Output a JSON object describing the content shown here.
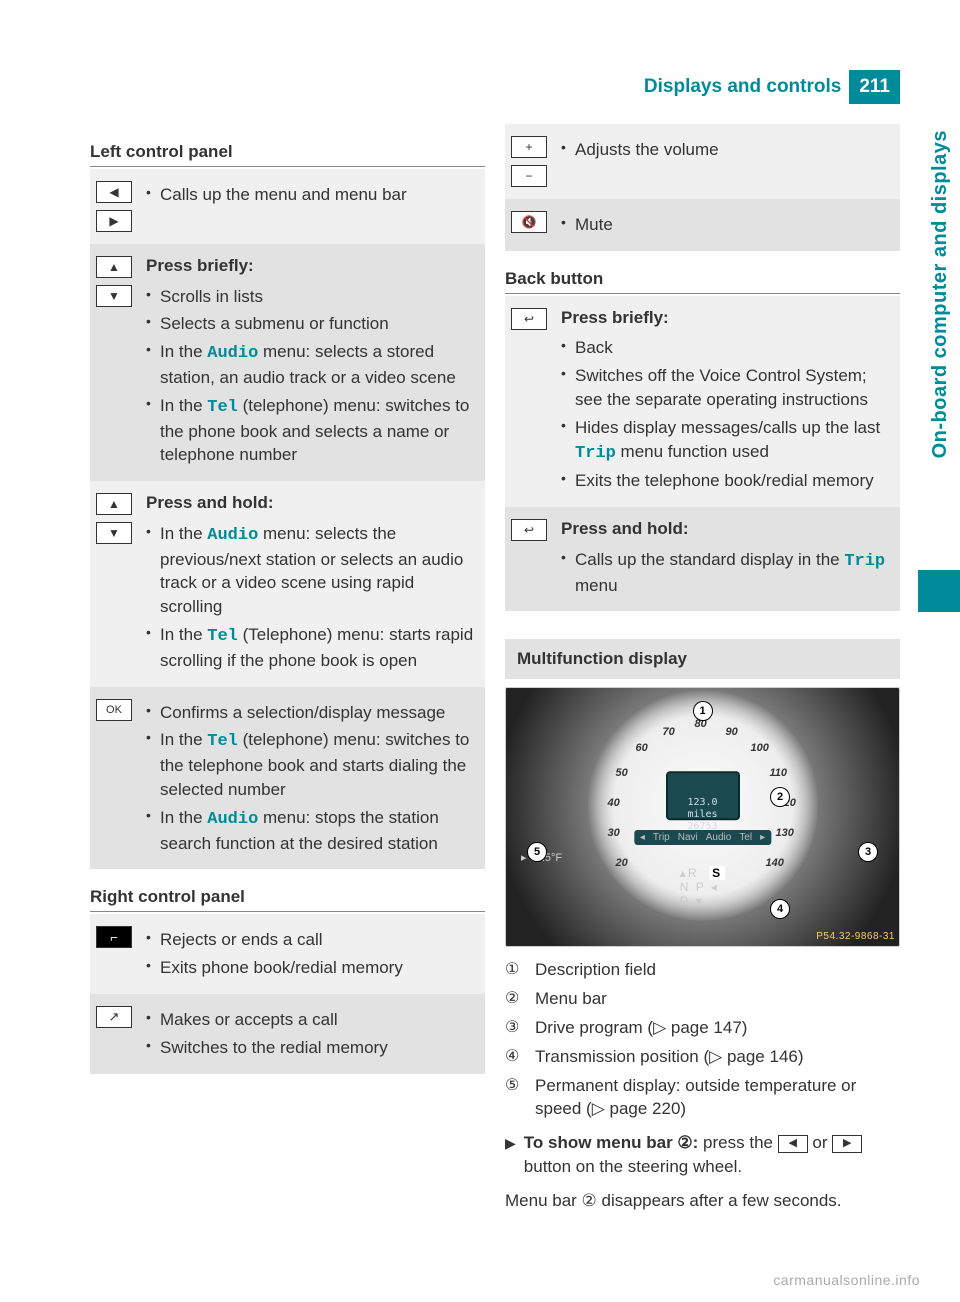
{
  "header": {
    "section": "Displays and controls",
    "page": "211"
  },
  "side_tab": "On-board computer and displays",
  "left_panel": {
    "title": "Left control panel",
    "rows": [
      {
        "items": [
          "Calls up the menu and menu bar"
        ]
      },
      {
        "heading": "Press briefly:",
        "items": [
          "Scrolls in lists",
          "Selects a submenu or function",
          {
            "pre": "In the ",
            "mono": "Audio",
            "post": " menu: selects a stored station, an audio track or a video scene"
          },
          {
            "pre": "In the ",
            "mono": "Tel",
            "post": " (telephone) menu: switches to the phone book and selects a name or telephone number"
          }
        ]
      },
      {
        "heading": "Press and hold:",
        "items": [
          {
            "pre": "In the ",
            "mono": "Audio",
            "post": " menu: selects the previous/next station or selects an audio track or a video scene using rapid scrolling"
          },
          {
            "pre": "In the ",
            "mono": "Tel",
            "post": " (Telephone) menu: starts rapid scrolling if the phone book is open"
          }
        ]
      },
      {
        "items": [
          "Confirms a selection/display message",
          {
            "pre": "In the ",
            "mono": "Tel",
            "post": " (telephone) menu: switches to the telephone book and starts dialing the selected number"
          },
          {
            "pre": "In the ",
            "mono": "Audio",
            "post": " menu: stops the station search function at the desired station"
          }
        ]
      }
    ]
  },
  "right_panel": {
    "title": "Right control panel",
    "rows": [
      {
        "items": [
          "Rejects or ends a call",
          "Exits phone book/redial memory"
        ]
      },
      {
        "items": [
          "Makes or accepts a call",
          "Switches to the redial memory"
        ]
      }
    ]
  },
  "right_col_top": [
    {
      "items": [
        "Adjusts the volume"
      ]
    },
    {
      "items": [
        "Mute"
      ]
    }
  ],
  "back_button": {
    "title": "Back button",
    "rows": [
      {
        "heading": "Press briefly:",
        "items": [
          "Back",
          "Switches off the Voice Control System; see the separate operating instructions",
          {
            "pre": "Hides display messages/calls up the last ",
            "mono": "Trip",
            "post": " menu function used"
          },
          "Exits the telephone book/redial memory"
        ]
      },
      {
        "heading": "Press and hold:",
        "items": [
          {
            "pre": "Calls up the standard display in the ",
            "mono": "Trip",
            "post": " menu"
          }
        ]
      }
    ]
  },
  "multi": {
    "title": "Multifunction display",
    "dial": {
      "trip": "123.0",
      "unit": "miles",
      "odo": "26753",
      "speeds": [
        "20",
        "30",
        "40",
        "50",
        "60",
        "70",
        "80",
        "90",
        "100",
        "110",
        "120",
        "130",
        "140"
      ]
    },
    "menubar": [
      "Trip",
      "Navi",
      "Audio",
      "Tel"
    ],
    "temp": "72.5°F",
    "gear_line": {
      "r": "R",
      "s": "S",
      "np": "N P",
      "d": "D"
    },
    "label": "P54.32-9868-31",
    "legend": [
      "Description field",
      "Menu bar",
      "Drive program (▷ page 147)",
      "Transmission position (▷ page 146)",
      "Permanent display: outside temperature or speed (▷ page 220)"
    ],
    "action_pre": "To show menu bar ②:",
    "action_post_1": " press the ",
    "action_post_2": " or ",
    "action_post_3": " button on the steering wheel.",
    "final": "Menu bar ② disappears after a few seconds."
  },
  "watermark": "carmanualsonline.info"
}
